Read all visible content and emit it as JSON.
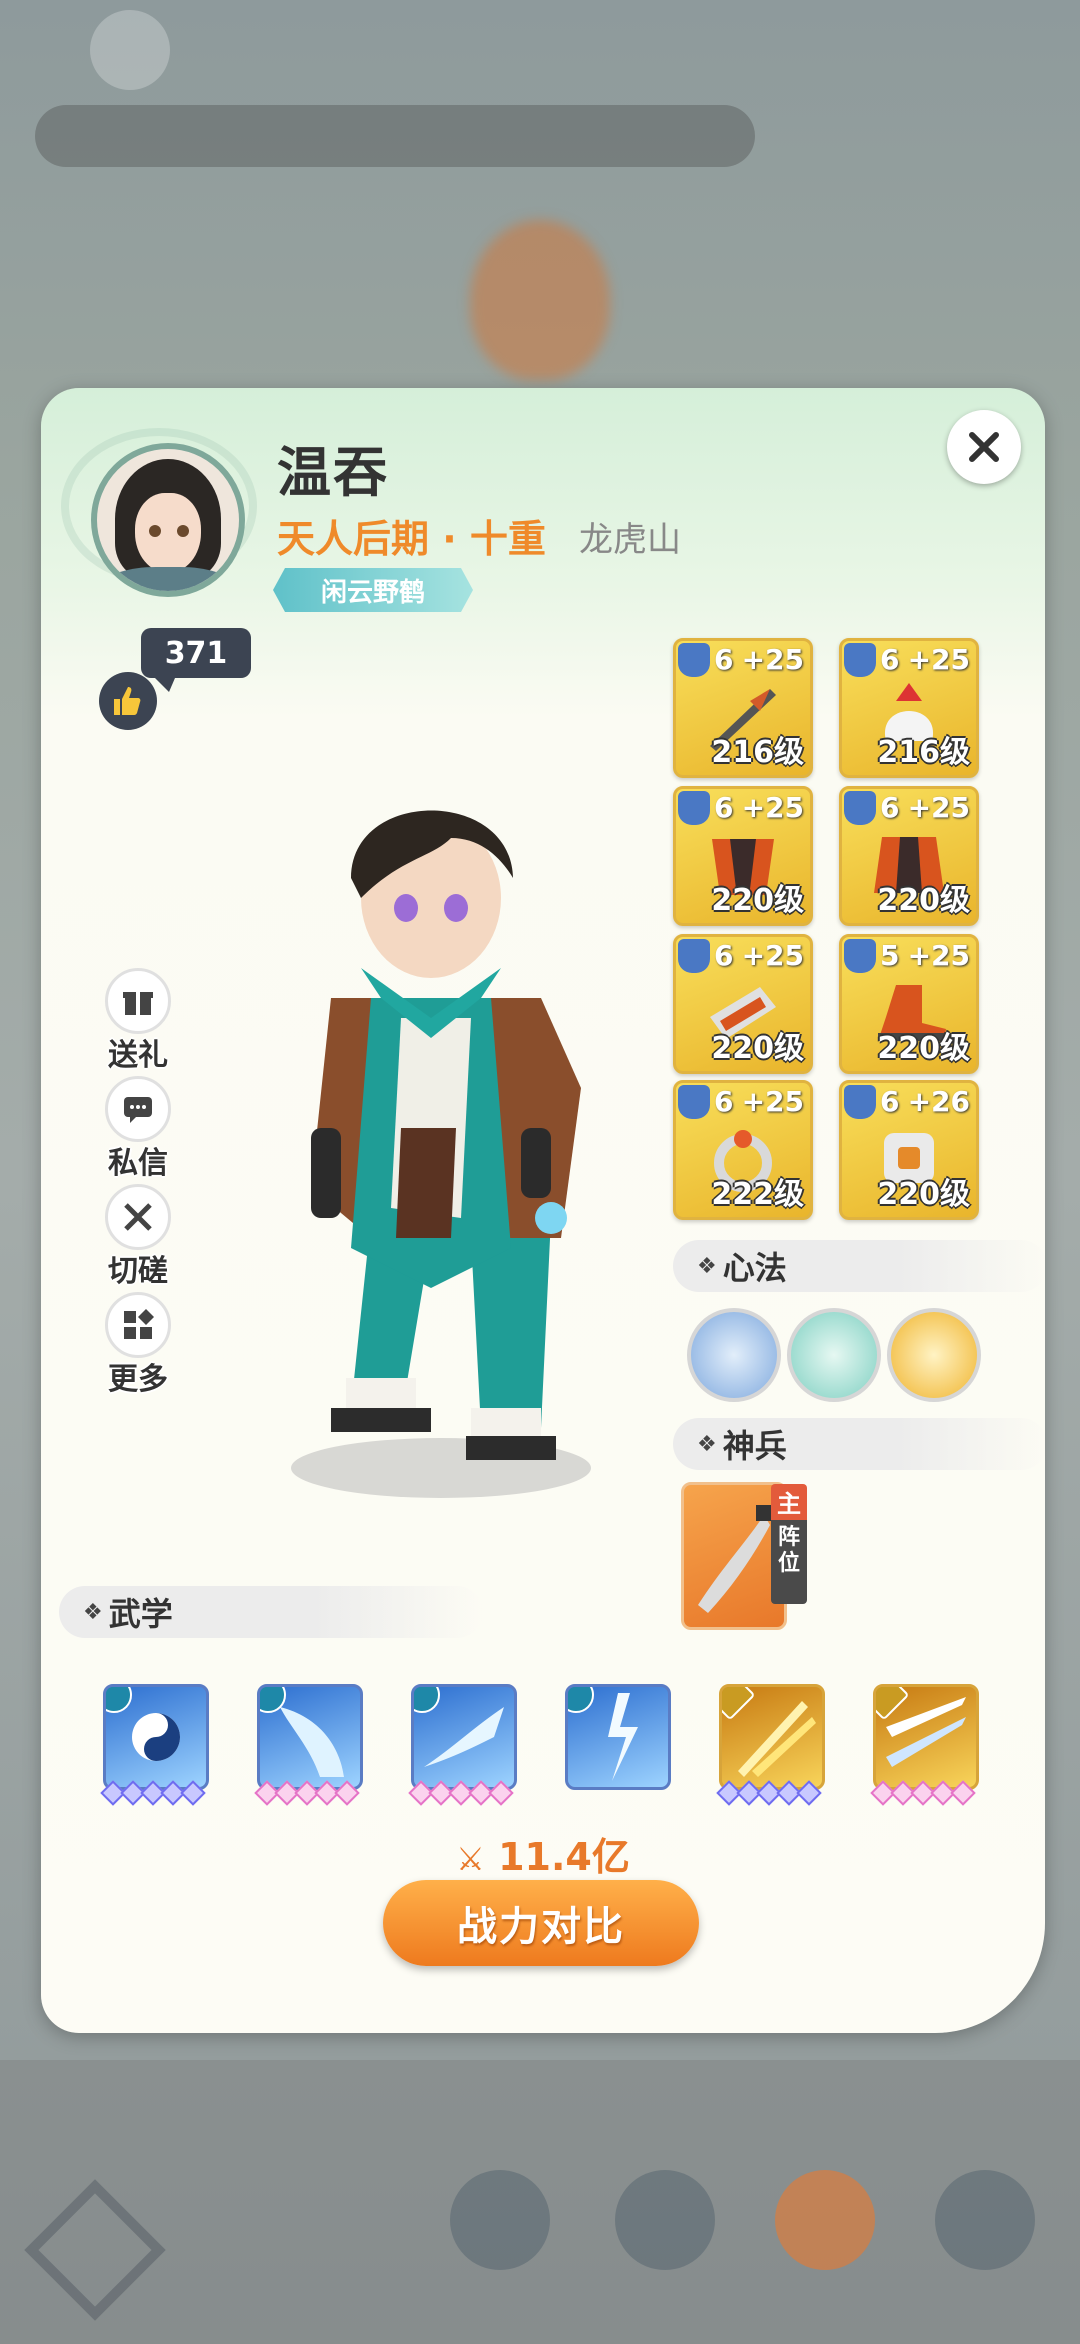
{
  "profile": {
    "name": "温吞",
    "realm": "天人后期 · 十重",
    "sect": "龙虎山",
    "title_badge": "闲云野鹤",
    "likes": "371"
  },
  "side_menu": [
    {
      "label": "送礼",
      "icon": "gift-icon"
    },
    {
      "label": "私信",
      "icon": "chat-icon"
    },
    {
      "label": "切磋",
      "icon": "crossed-swords-icon"
    },
    {
      "label": "更多",
      "icon": "more-icon"
    }
  ],
  "equipment": [
    {
      "star": "6",
      "plus": "+25",
      "level": "216级"
    },
    {
      "star": "6",
      "plus": "+25",
      "level": "216级"
    },
    {
      "star": "6",
      "plus": "+25",
      "level": "220级"
    },
    {
      "star": "6",
      "plus": "+25",
      "level": "220级"
    },
    {
      "star": "6",
      "plus": "+25",
      "level": "220级"
    },
    {
      "star": "5",
      "plus": "+25",
      "level": "220级"
    },
    {
      "star": "6",
      "plus": "+25",
      "level": "222级"
    },
    {
      "star": "6",
      "plus": "+26",
      "level": "220级"
    }
  ],
  "sections": {
    "xinfa": "心法",
    "shenbing": "神兵",
    "wuxue": "武学"
  },
  "shenbing_tag": {
    "main": "主",
    "pos": "阵位"
  },
  "power": "11.4亿",
  "compare_button": "战力对比",
  "colors": {
    "accent": "#ef8a2a",
    "equip_gold": "#f3cf4a",
    "button": "#f29a34"
  }
}
